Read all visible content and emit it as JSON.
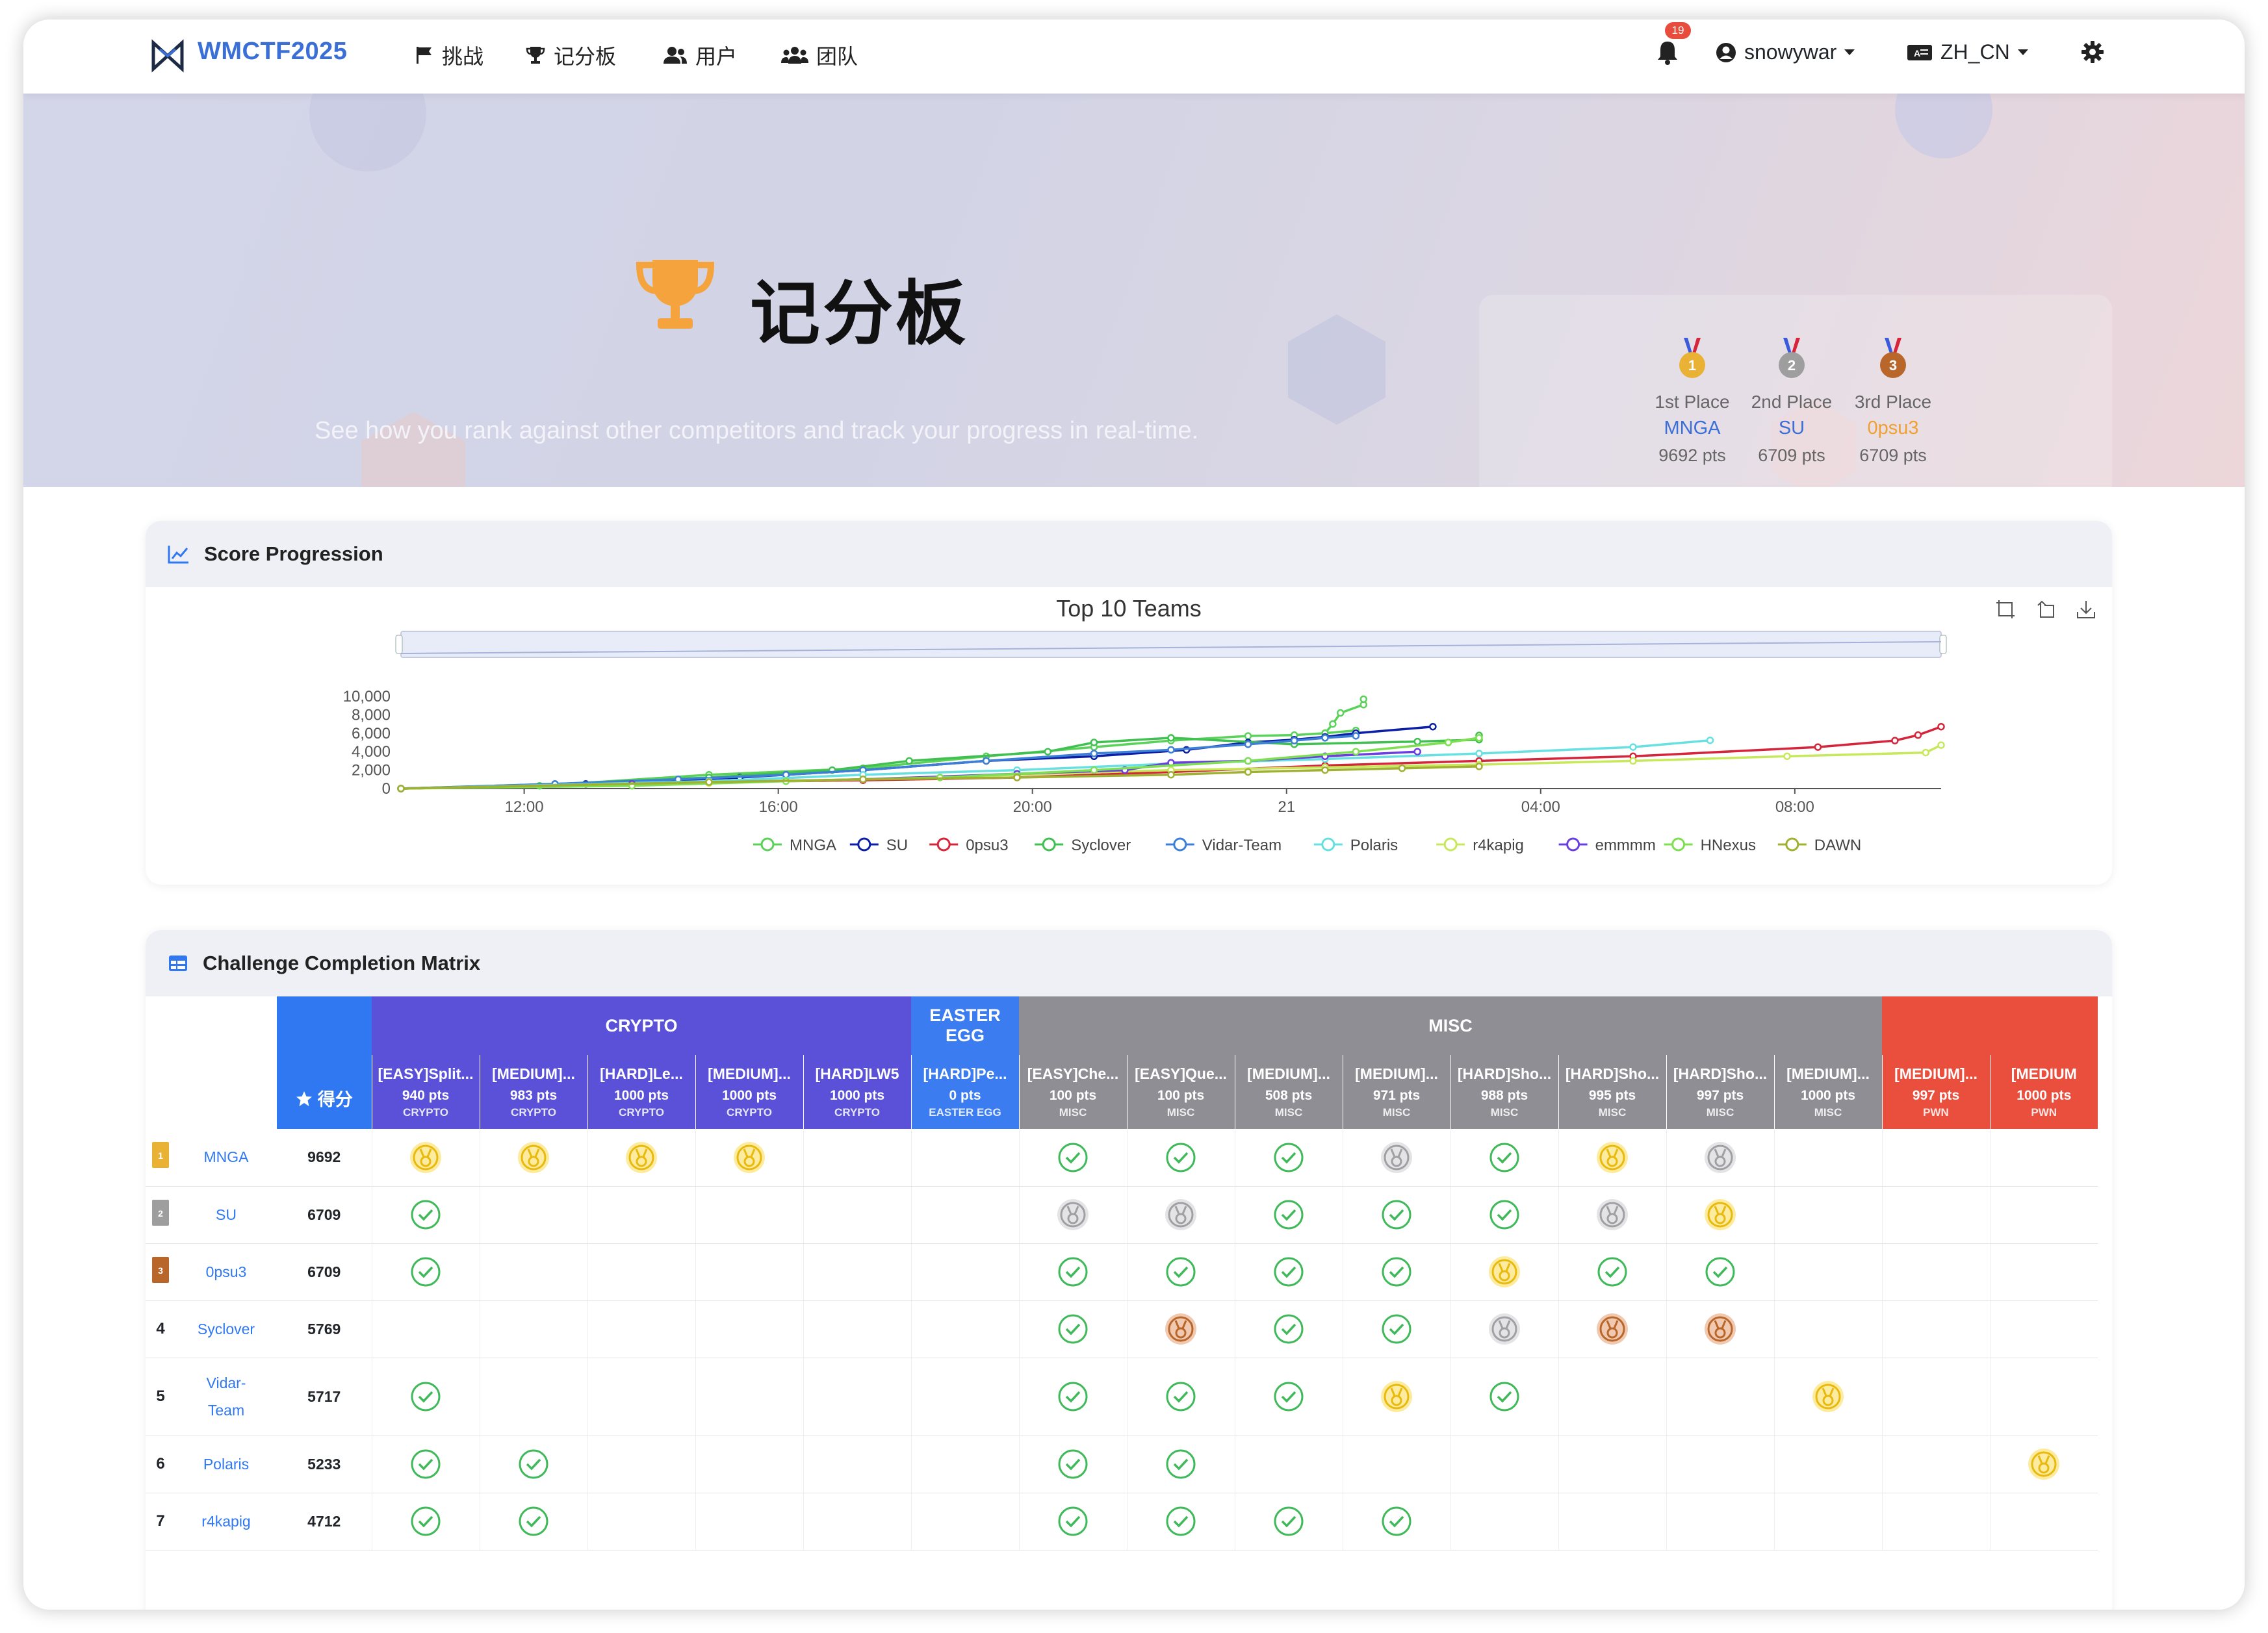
{
  "nav": {
    "brand": "WMCTF2025",
    "items": [
      "挑战",
      "记分板",
      "用户",
      "团队"
    ],
    "notification_count": "19",
    "username": "snowywar",
    "language": "ZH_CN"
  },
  "hero": {
    "title": "记分板",
    "subtitle": "See how you rank against other competitors and track your progress in real-time.",
    "podium": [
      {
        "rank": "1",
        "label": "1st Place",
        "team": "MNGA",
        "points": "9692 pts",
        "color": "#3a6fd8",
        "medal": "#e9b234"
      },
      {
        "rank": "2",
        "label": "2nd Place",
        "team": "SU",
        "points": "6709 pts",
        "color": "#3a6fd8",
        "medal": "#9e9e9e"
      },
      {
        "rank": "3",
        "label": "3rd Place",
        "team": "0psu3",
        "points": "6709 pts",
        "color": "#f0a030",
        "medal": "#b8662a"
      }
    ]
  },
  "score_progression": {
    "card_title": "Score Progression",
    "chart_data": {
      "type": "line",
      "title": "Top 10 Teams",
      "x_ticks": [
        "12:00",
        "16:00",
        "20:00",
        "21",
        "04:00",
        "08:00"
      ],
      "y_ticks": [
        "10,000",
        "8,000",
        "6,000",
        "4,000",
        "2,000",
        "0"
      ],
      "ylim": [
        0,
        10000
      ],
      "legend_position": "bottom",
      "series": [
        {
          "name": "MNGA",
          "color": "#5ad25a",
          "values": [
            [
              0.0,
              0
            ],
            [
              0.09,
              300
            ],
            [
              0.2,
              1500
            ],
            [
              0.3,
              2200
            ],
            [
              0.38,
              3500
            ],
            [
              0.45,
              4500
            ],
            [
              0.5,
              5200
            ],
            [
              0.55,
              5700
            ],
            [
              0.58,
              5800
            ],
            [
              0.6,
              6000
            ],
            [
              0.62,
              6300
            ],
            [
              0.6,
              6000
            ],
            [
              0.605,
              7000
            ],
            [
              0.61,
              8200
            ],
            [
              0.625,
              9100
            ],
            [
              0.625,
              9692
            ]
          ]
        },
        {
          "name": "SU",
          "color": "#0a1fa6",
          "values": [
            [
              0.0,
              0
            ],
            [
              0.12,
              500
            ],
            [
              0.22,
              1200
            ],
            [
              0.25,
              1500
            ],
            [
              0.3,
              2000
            ],
            [
              0.38,
              3000
            ],
            [
              0.45,
              3500
            ],
            [
              0.51,
              4200
            ],
            [
              0.55,
              5000
            ],
            [
              0.58,
              5300
            ],
            [
              0.6,
              5600
            ],
            [
              0.62,
              6000
            ],
            [
              0.67,
              6709
            ]
          ]
        },
        {
          "name": "0psu3",
          "color": "#d6243a",
          "values": [
            [
              0.0,
              0
            ],
            [
              0.2,
              700
            ],
            [
              0.3,
              900
            ],
            [
              0.4,
              1200
            ],
            [
              0.5,
              1800
            ],
            [
              0.6,
              2500
            ],
            [
              0.7,
              3000
            ],
            [
              0.8,
              3500
            ],
            [
              0.92,
              4500
            ],
            [
              0.97,
              5200
            ],
            [
              0.985,
              5800
            ],
            [
              1.0,
              6709
            ]
          ]
        },
        {
          "name": "Syclover",
          "color": "#40c050",
          "values": [
            [
              0.0,
              0
            ],
            [
              0.1,
              500
            ],
            [
              0.2,
              1200
            ],
            [
              0.28,
              2000
            ],
            [
              0.33,
              3000
            ],
            [
              0.42,
              4000
            ],
            [
              0.45,
              5000
            ],
            [
              0.5,
              5500
            ],
            [
              0.58,
              4800
            ],
            [
              0.66,
              5100
            ],
            [
              0.7,
              5300
            ],
            [
              0.7,
              5769
            ]
          ]
        },
        {
          "name": "Vidar-Team",
          "color": "#3d7fd6",
          "values": [
            [
              0.0,
              0
            ],
            [
              0.1,
              500
            ],
            [
              0.18,
              1000
            ],
            [
              0.25,
              1500
            ],
            [
              0.3,
              2000
            ],
            [
              0.38,
              3000
            ],
            [
              0.45,
              3800
            ],
            [
              0.5,
              4200
            ],
            [
              0.55,
              4800
            ],
            [
              0.58,
              5200
            ],
            [
              0.6,
              5500
            ],
            [
              0.62,
              5717
            ]
          ]
        },
        {
          "name": "Polaris",
          "color": "#66e0e0",
          "values": [
            [
              0.0,
              0
            ],
            [
              0.2,
              800
            ],
            [
              0.3,
              1500
            ],
            [
              0.4,
              2000
            ],
            [
              0.5,
              2700
            ],
            [
              0.6,
              3200
            ],
            [
              0.7,
              3800
            ],
            [
              0.8,
              4500
            ],
            [
              0.85,
              5233
            ]
          ]
        },
        {
          "name": "r4kapig",
          "color": "#c7e85a",
          "values": [
            [
              0.0,
              0
            ],
            [
              0.2,
              600
            ],
            [
              0.3,
              1000
            ],
            [
              0.4,
              1500
            ],
            [
              0.5,
              2000
            ],
            [
              0.6,
              2300
            ],
            [
              0.7,
              2600
            ],
            [
              0.8,
              3000
            ],
            [
              0.9,
              3500
            ],
            [
              0.99,
              3900
            ],
            [
              1.0,
              4712
            ]
          ]
        },
        {
          "name": "emmmm",
          "color": "#6a3ee0",
          "values": [
            [
              0.0,
              0
            ],
            [
              0.15,
              500
            ],
            [
              0.3,
              1000
            ],
            [
              0.4,
              1600
            ],
            [
              0.47,
              2000
            ],
            [
              0.5,
              2800
            ],
            [
              0.55,
              3000
            ],
            [
              0.6,
              3500
            ],
            [
              0.66,
              4000
            ]
          ]
        },
        {
          "name": "HNexus",
          "color": "#7ee050",
          "values": [
            [
              0.0,
              0
            ],
            [
              0.15,
              300
            ],
            [
              0.25,
              800
            ],
            [
              0.35,
              1200
            ],
            [
              0.45,
              2000
            ],
            [
              0.55,
              3000
            ],
            [
              0.62,
              4000
            ],
            [
              0.68,
              5000
            ],
            [
              0.7,
              5500
            ]
          ]
        },
        {
          "name": "DAWN",
          "color": "#a0b030",
          "values": [
            [
              0.0,
              0
            ],
            [
              0.2,
              700
            ],
            [
              0.3,
              1000
            ],
            [
              0.4,
              1200
            ],
            [
              0.5,
              1500
            ],
            [
              0.55,
              1800
            ],
            [
              0.6,
              2000
            ],
            [
              0.65,
              2200
            ],
            [
              0.7,
              2400
            ]
          ]
        }
      ]
    }
  },
  "matrix": {
    "card_title": "Challenge Completion Matrix",
    "score_header": "得分",
    "categories": [
      {
        "name": "CRYPTO",
        "span": 5,
        "color": "#5a51d8"
      },
      {
        "name": "EASTER EGG",
        "span": 1,
        "color": "#3b7cf0"
      },
      {
        "name": "MISC",
        "span": 8,
        "color": "#8e8e94"
      },
      {
        "name": "",
        "span": 2,
        "color": "#ea4e3d"
      }
    ],
    "challenges": [
      {
        "name": "[EASY]Split...",
        "pts": "940 pts",
        "cat": "CRYPTO",
        "color": "#5a51d8"
      },
      {
        "name": "[MEDIUM]...",
        "pts": "983 pts",
        "cat": "CRYPTO",
        "color": "#5a51d8"
      },
      {
        "name": "[HARD]Le...",
        "pts": "1000 pts",
        "cat": "CRYPTO",
        "color": "#5a51d8"
      },
      {
        "name": "[MEDIUM]...",
        "pts": "1000 pts",
        "cat": "CRYPTO",
        "color": "#5a51d8"
      },
      {
        "name": "[HARD]LW5",
        "pts": "1000 pts",
        "cat": "CRYPTO",
        "color": "#5a51d8"
      },
      {
        "name": "[HARD]Pe...",
        "pts": "0 pts",
        "cat": "EASTER EGG",
        "color": "#3b7cf0"
      },
      {
        "name": "[EASY]Che...",
        "pts": "100 pts",
        "cat": "MISC",
        "color": "#8e8e94"
      },
      {
        "name": "[EASY]Que...",
        "pts": "100 pts",
        "cat": "MISC",
        "color": "#8e8e94"
      },
      {
        "name": "[MEDIUM]...",
        "pts": "508 pts",
        "cat": "MISC",
        "color": "#8e8e94"
      },
      {
        "name": "[MEDIUM]...",
        "pts": "971 pts",
        "cat": "MISC",
        "color": "#8e8e94"
      },
      {
        "name": "[HARD]Sho...",
        "pts": "988 pts",
        "cat": "MISC",
        "color": "#8e8e94"
      },
      {
        "name": "[HARD]Sho...",
        "pts": "995 pts",
        "cat": "MISC",
        "color": "#8e8e94"
      },
      {
        "name": "[HARD]Sho...",
        "pts": "997 pts",
        "cat": "MISC",
        "color": "#8e8e94"
      },
      {
        "name": "[MEDIUM]...",
        "pts": "1000 pts",
        "cat": "MISC",
        "color": "#8e8e94"
      },
      {
        "name": "[MEDIUM]...",
        "pts": "997 pts",
        "cat": "PWN",
        "color": "#ea4e3d"
      },
      {
        "name": "[MEDIUM",
        "pts": "1000 pts",
        "cat": "PWN",
        "color": "#ea4e3d"
      }
    ],
    "rows": [
      {
        "rank": "1",
        "medal": "#e9b234",
        "team": "MNGA",
        "score": "9692",
        "cells": [
          "g",
          "g",
          "g",
          "g",
          "",
          "",
          "c",
          "c",
          "c",
          "s",
          "c",
          "g",
          "s",
          "",
          "",
          ""
        ]
      },
      {
        "rank": "2",
        "medal": "#9e9e9e",
        "team": "SU",
        "score": "6709",
        "cells": [
          "c",
          "",
          "",
          "",
          "",
          "",
          "s",
          "s",
          "c",
          "c",
          "c",
          "s",
          "g",
          "",
          "",
          ""
        ]
      },
      {
        "rank": "3",
        "medal": "#b8662a",
        "team": "0psu3",
        "score": "6709",
        "cells": [
          "c",
          "",
          "",
          "",
          "",
          "",
          "c",
          "c",
          "c",
          "c",
          "g",
          "c",
          "c",
          "",
          "",
          ""
        ]
      },
      {
        "rank": "4",
        "medal": "",
        "team": "Syclover",
        "score": "5769",
        "cells": [
          "",
          "",
          "",
          "",
          "",
          "",
          "c",
          "b",
          "c",
          "c",
          "s",
          "b",
          "b",
          "",
          "",
          ""
        ]
      },
      {
        "rank": "5",
        "medal": "",
        "team": "Vidar-Team",
        "score": "5717",
        "cells": [
          "c",
          "",
          "",
          "",
          "",
          "",
          "c",
          "c",
          "c",
          "g",
          "c",
          "",
          "",
          "g",
          "",
          ""
        ]
      },
      {
        "rank": "6",
        "medal": "",
        "team": "Polaris",
        "score": "5233",
        "cells": [
          "c",
          "c",
          "",
          "",
          "",
          "",
          "c",
          "c",
          "",
          "",
          "",
          "",
          "",
          "",
          "",
          "g"
        ]
      },
      {
        "rank": "7",
        "medal": "",
        "team": "r4kapig",
        "score": "4712",
        "cells": [
          "c",
          "c",
          "",
          "",
          "",
          "",
          "c",
          "c",
          "c",
          "c",
          "",
          "",
          "",
          "",
          "",
          ""
        ]
      }
    ]
  }
}
